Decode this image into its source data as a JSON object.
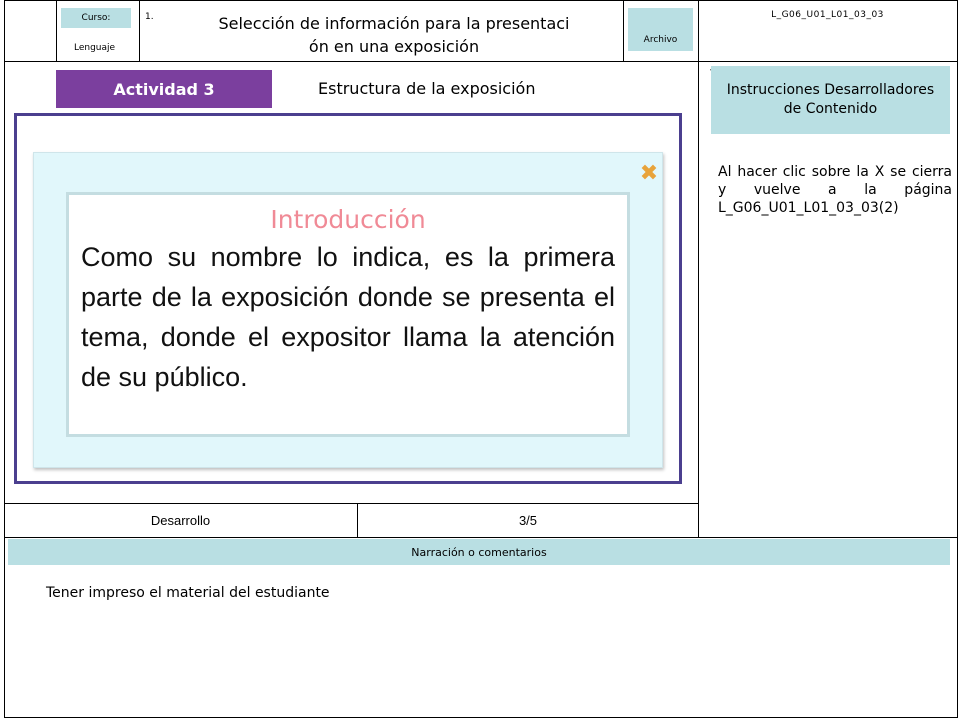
{
  "header": {
    "course_label": "Curso:",
    "course_value": "Lenguaje",
    "item_number": "1.",
    "title_line1": "Selección de información para la presentaci",
    "title_line2": "ón en una exposición",
    "file_label": "Archivo",
    "file_code": "L_G06_U01_L01_03_03"
  },
  "activity": {
    "badge": "Actividad 3",
    "subtitle": "Estructura de la exposición"
  },
  "popup": {
    "close_glyph": "✖",
    "heading": "Introducción",
    "body": "Como su nombre lo indica, es la primera parte de la exposición donde se presenta el tema, donde el expositor llama la atención de su público."
  },
  "instructions": {
    "title": "Instrucciones Desarrolladores de Contenido",
    "text": "Al hacer clic sobre la X se cierra y vuelve a la página L_G06_U01_L01_03_03(2)"
  },
  "footer_row": {
    "section": "Desarrollo",
    "page": "3/5"
  },
  "narration": {
    "label": "Narración o comentarios",
    "text": "Tener impreso el material del estudiante"
  },
  "colors": {
    "accent_purple": "#7b3f9e",
    "frame_purple": "#4b3f8f",
    "tag_blue": "#b9dfe3",
    "close_orange": "#e8a33a",
    "heading_pink": "#f08a96"
  }
}
